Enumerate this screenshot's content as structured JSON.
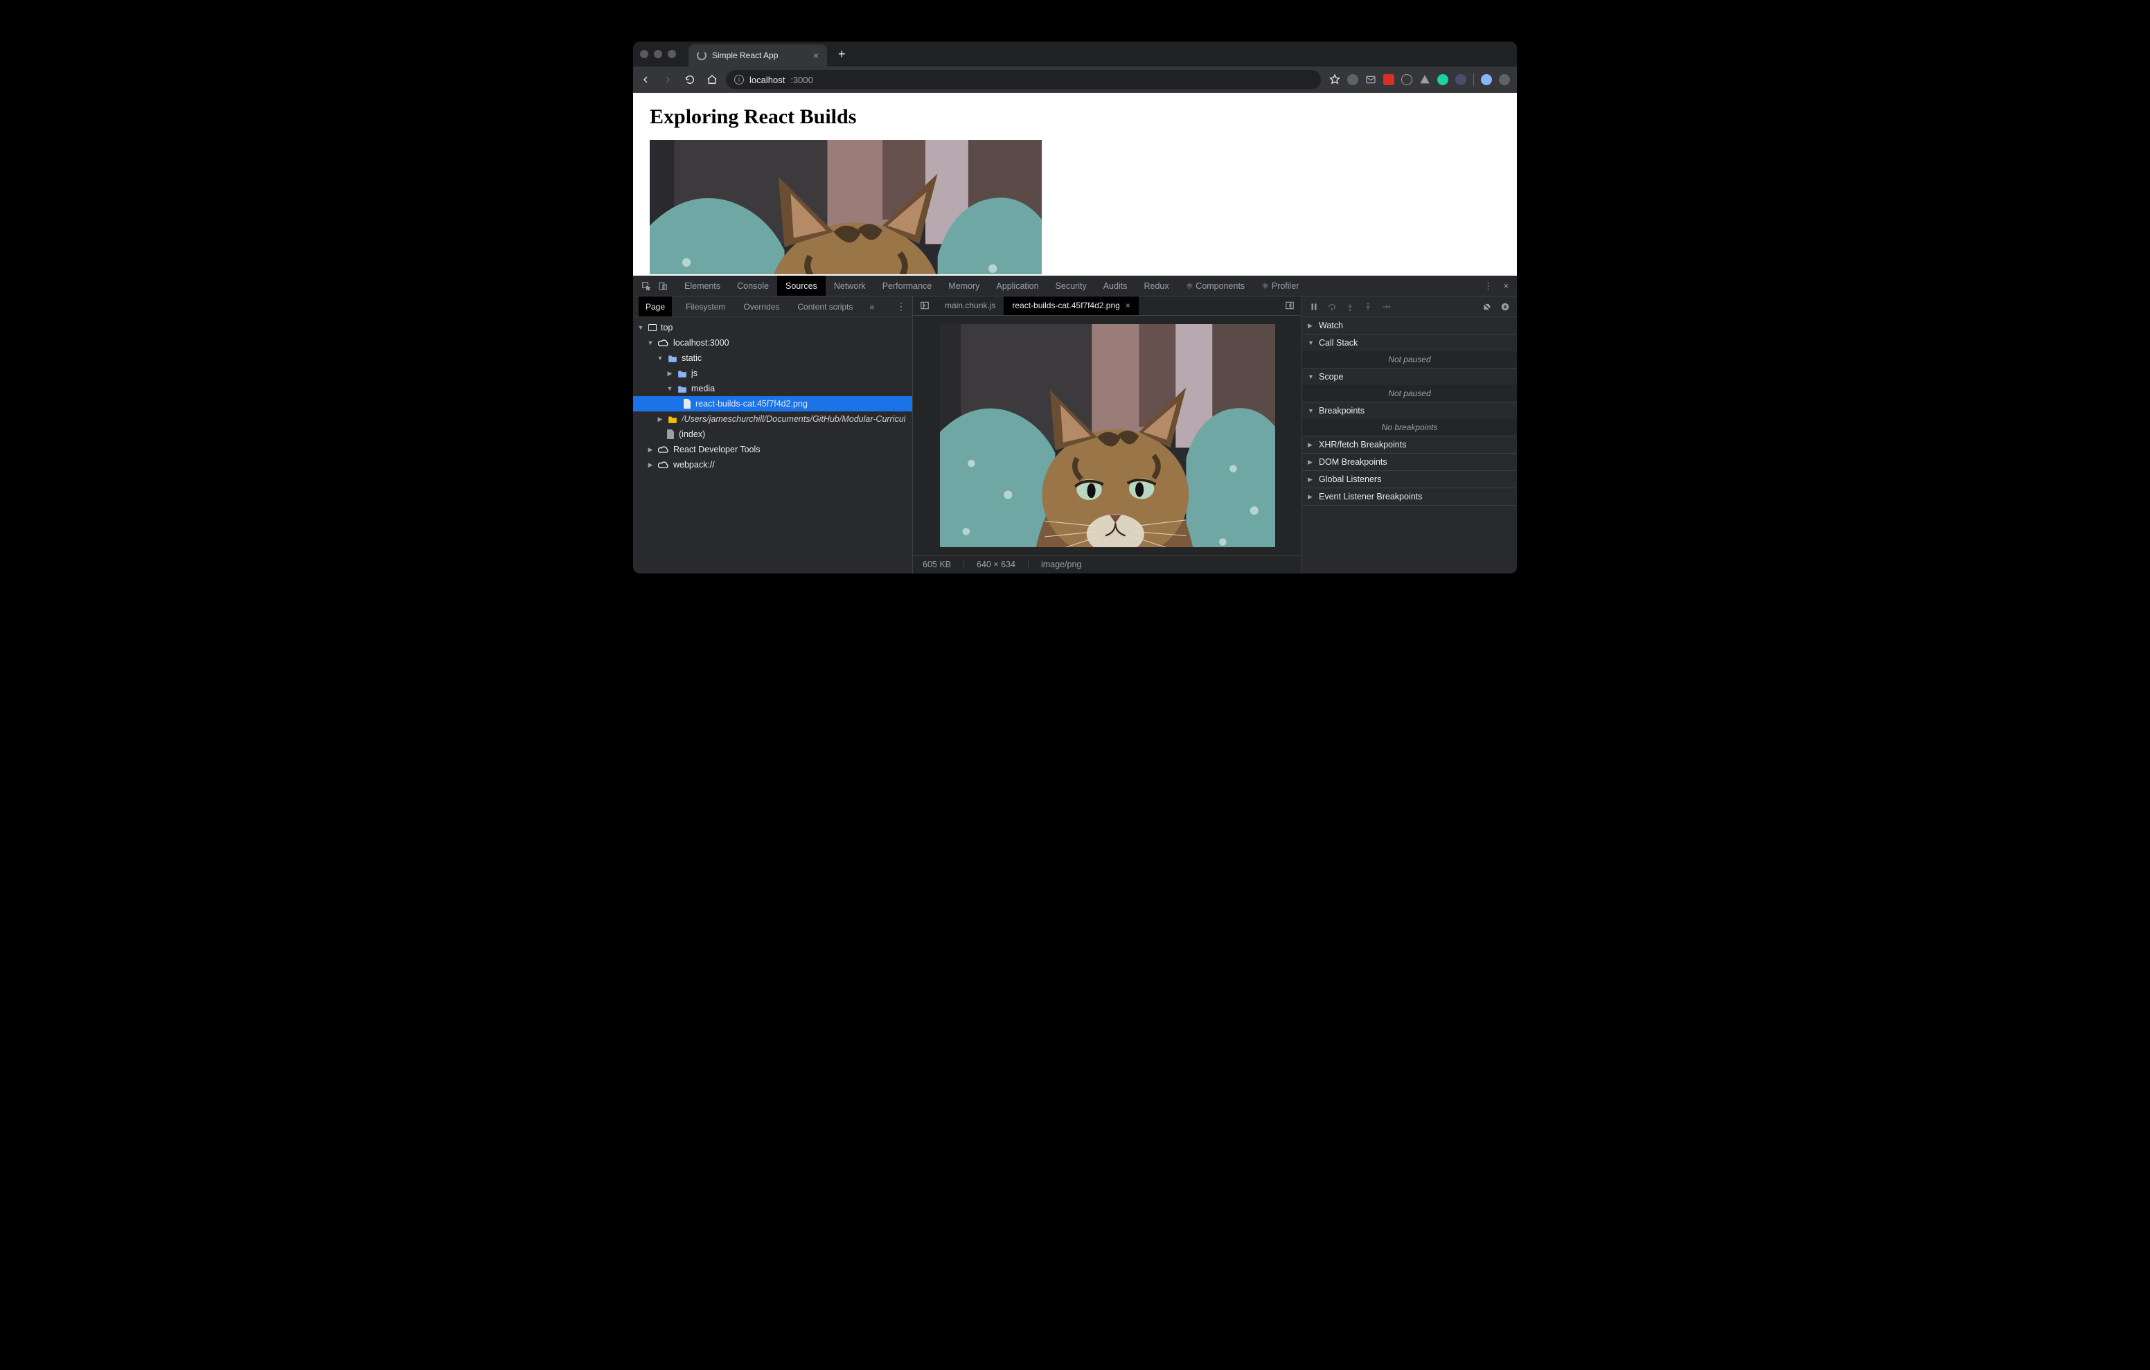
{
  "titlebar": {
    "tab_title": "Simple React App"
  },
  "toolbar": {
    "url_host": "localhost",
    "url_port": ":3000"
  },
  "page": {
    "heading": "Exploring React Builds"
  },
  "devtools": {
    "panels": [
      "Elements",
      "Console",
      "Sources",
      "Network",
      "Performance",
      "Memory",
      "Application",
      "Security",
      "Audits",
      "Redux",
      "⚛ Components",
      "⚛ Profiler"
    ],
    "active_panel": "Sources",
    "left_tabs": [
      "Page",
      "Filesystem",
      "Overrides",
      "Content scripts"
    ],
    "left_active": "Page",
    "tree": {
      "top": "top",
      "origin": "localhost:3000",
      "static": "static",
      "js": "js",
      "media": "media",
      "selected_file": "react-builds-cat.45f7f4d2.png",
      "long_folder": "/Users/jameschurchill/Documents/GitHub/Modular-Curricul",
      "index": "(index)",
      "rdt": "React Developer Tools",
      "webpack": "webpack://"
    },
    "editor_tabs": {
      "inactive": "main.chunk.js",
      "active": "react-builds-cat.45f7f4d2.png"
    },
    "statusbar": {
      "size": "605 KB",
      "dims": "640 × 634",
      "mime": "image/png"
    },
    "debugger": {
      "watch": "Watch",
      "callstack": "Call Stack",
      "not_paused": "Not paused",
      "scope": "Scope",
      "breakpoints": "Breakpoints",
      "no_breakpoints": "No breakpoints",
      "xhr": "XHR/fetch Breakpoints",
      "dom": "DOM Breakpoints",
      "global": "Global Listeners",
      "event": "Event Listener Breakpoints"
    }
  }
}
